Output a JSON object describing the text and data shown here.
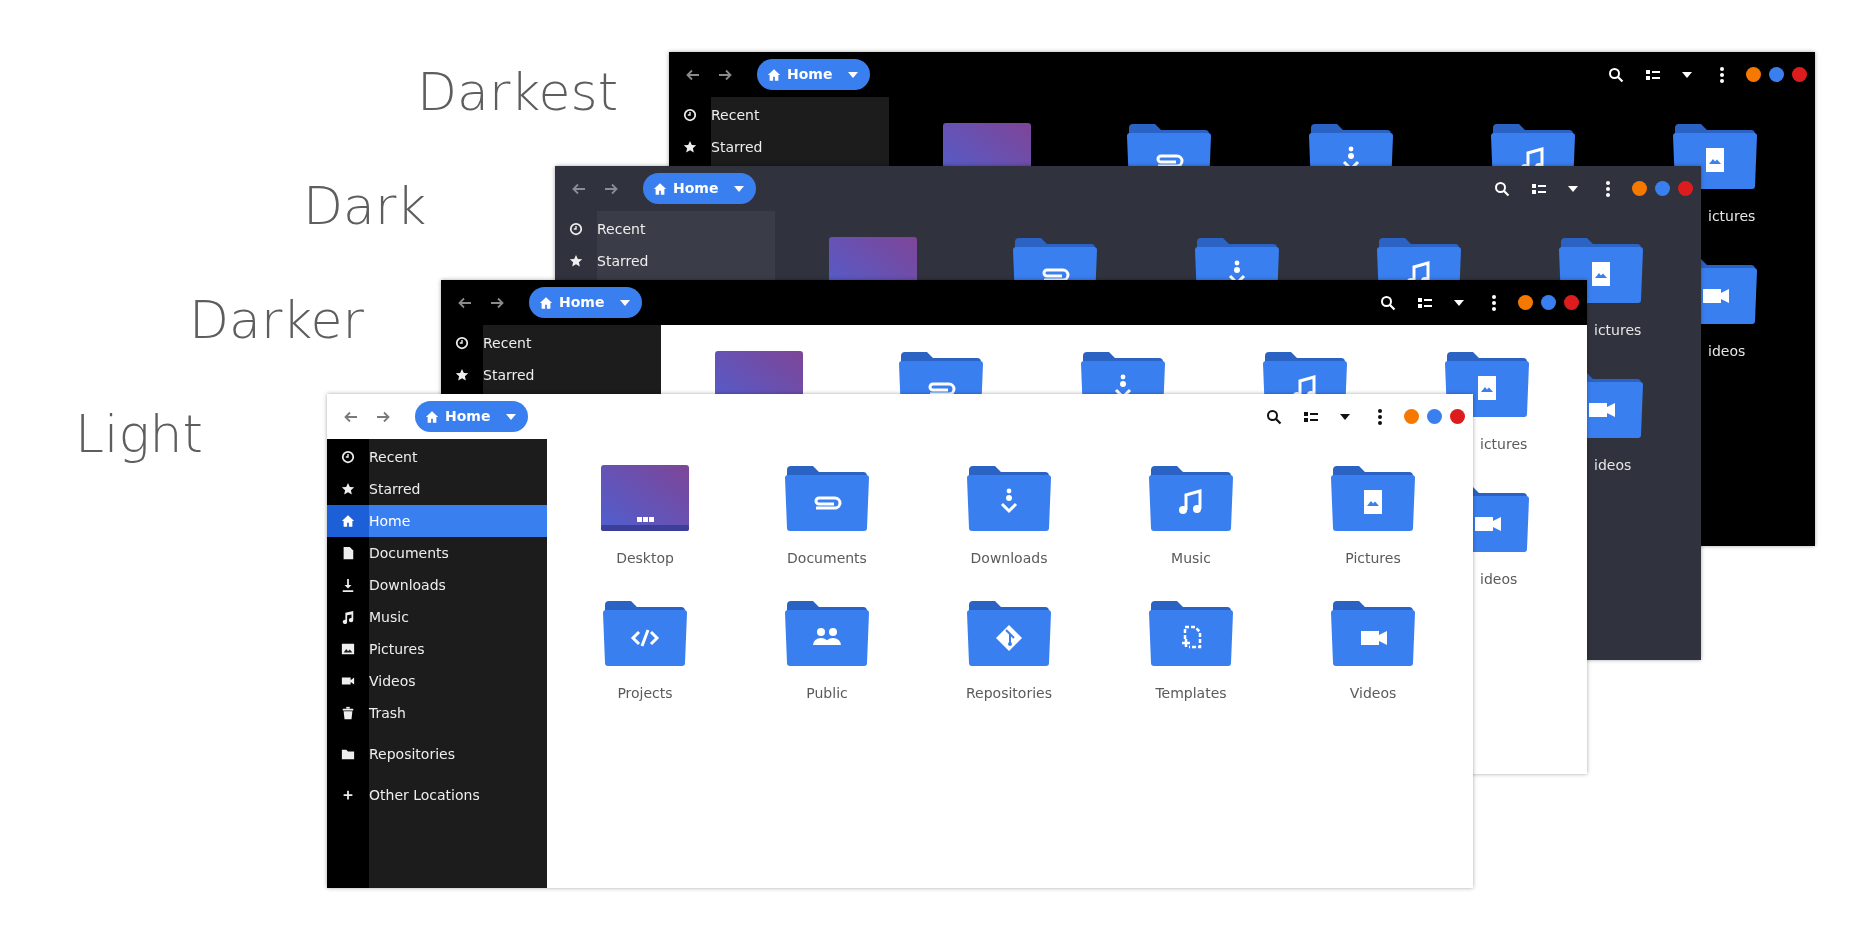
{
  "windows": [
    {
      "kind": "darkest",
      "caption": "Darkest",
      "location": "Home",
      "window_controls": [
        {
          "color": "#f57900"
        },
        {
          "color": "#3a7ff0"
        },
        {
          "color": "#dd1d1d"
        }
      ],
      "sidebar": {
        "groups": [
          [
            {
              "kind": "clock",
              "label": "Recent",
              "selected": false
            },
            {
              "kind": "star",
              "label": "Starred",
              "selected": false
            }
          ]
        ]
      },
      "rows": [
        [
          {
            "kind": "desktop"
          },
          {
            "kind": "clip"
          },
          {
            "kind": "download"
          },
          {
            "kind": "music"
          },
          {
            "kind": "image",
            "label": "ictures"
          }
        ],
        [
          {
            "kind": "video",
            "label": "ideos"
          }
        ]
      ]
    },
    {
      "kind": "dark",
      "caption": "Dark",
      "location": "Home",
      "window_controls": [
        {
          "color": "#f57900"
        },
        {
          "color": "#3a7ff0"
        },
        {
          "color": "#dd1d1d"
        }
      ],
      "sidebar": {
        "groups": [
          [
            {
              "kind": "clock",
              "label": "Recent",
              "selected": false
            },
            {
              "kind": "star",
              "label": "Starred",
              "selected": false
            }
          ]
        ]
      },
      "rows": [
        [
          {
            "kind": "desktop"
          },
          {
            "kind": "clip"
          },
          {
            "kind": "download"
          },
          {
            "kind": "music"
          },
          {
            "kind": "image",
            "label": "ictures"
          }
        ],
        [
          {
            "kind": "video",
            "label": "ideos"
          }
        ]
      ]
    },
    {
      "kind": "darker",
      "caption": "Darker",
      "location": "Home",
      "window_controls": [
        {
          "color": "#f57900"
        },
        {
          "color": "#3a7ff0"
        },
        {
          "color": "#dd1d1d"
        }
      ],
      "sidebar": {
        "groups": [
          [
            {
              "kind": "clock",
              "label": "Recent",
              "selected": false
            },
            {
              "kind": "star",
              "label": "Starred",
              "selected": false
            }
          ]
        ]
      },
      "rows": [
        [
          {
            "kind": "desktop"
          },
          {
            "kind": "clip"
          },
          {
            "kind": "download"
          },
          {
            "kind": "music"
          },
          {
            "kind": "image",
            "label": "ictures"
          }
        ],
        [
          {
            "kind": "video",
            "label": "ideos"
          }
        ]
      ]
    },
    {
      "kind": "light",
      "caption": "Light",
      "location": "Home",
      "window_controls": [
        {
          "color": "#f57900"
        },
        {
          "color": "#3a7ff0"
        },
        {
          "color": "#dd1d1d"
        }
      ],
      "sidebar": {
        "groups": [
          [
            {
              "kind": "clock",
              "label": "Recent",
              "selected": false
            },
            {
              "kind": "star",
              "label": "Starred",
              "selected": false
            },
            {
              "kind": "home",
              "label": "Home",
              "selected": true
            },
            {
              "kind": "file",
              "label": "Documents",
              "selected": false
            },
            {
              "kind": "download",
              "label": "Downloads",
              "selected": false
            },
            {
              "kind": "music",
              "label": "Music",
              "selected": false
            },
            {
              "kind": "image",
              "label": "Pictures",
              "selected": false
            },
            {
              "kind": "video",
              "label": "Videos",
              "selected": false
            },
            {
              "kind": "trash",
              "label": "Trash",
              "selected": false
            }
          ],
          [
            {
              "kind": "folder",
              "label": "Repositories",
              "selected": false
            }
          ],
          [
            {
              "kind": "plus",
              "label": "Other Locations",
              "selected": false
            }
          ]
        ]
      },
      "rows": [
        [
          {
            "kind": "desktop",
            "label": "Desktop"
          },
          {
            "kind": "clip",
            "label": "Documents"
          },
          {
            "kind": "download",
            "label": "Downloads"
          },
          {
            "kind": "music",
            "label": "Music"
          },
          {
            "kind": "image",
            "label": "Pictures"
          }
        ],
        [
          {
            "kind": "code",
            "label": "Projects"
          },
          {
            "kind": "people",
            "label": "Public"
          },
          {
            "kind": "git",
            "label": "Repositories"
          },
          {
            "kind": "template",
            "label": "Templates"
          },
          {
            "kind": "video",
            "label": "Videos"
          }
        ]
      ]
    }
  ]
}
